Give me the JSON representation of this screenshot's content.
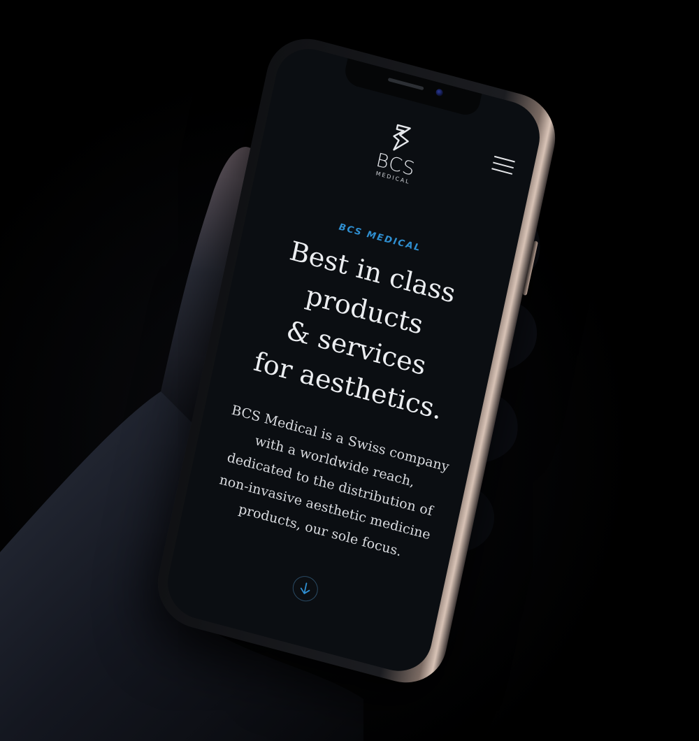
{
  "site": {
    "logo": {
      "wordmark": "BCS",
      "subline": "MEDICAL",
      "icon": "bcs-zigzag-logo-icon"
    },
    "menu_icon": "hamburger-menu-icon",
    "eyebrow": "BCS MEDICAL",
    "headline_lines": [
      "Best in class",
      "products",
      "& services",
      "for aesthetics."
    ],
    "intro_lines": [
      "BCS Medical is a Swiss company",
      "with a worldwide reach,",
      "dedicated to the distribution of",
      "non-invasive aesthetic medicine",
      "products, our sole focus."
    ],
    "scroll_icon": "arrow-down-circle-icon"
  },
  "colors": {
    "background": "#000000",
    "screen": "#0b0e12",
    "accent": "#2f8fd1",
    "text": "#eceef1"
  }
}
